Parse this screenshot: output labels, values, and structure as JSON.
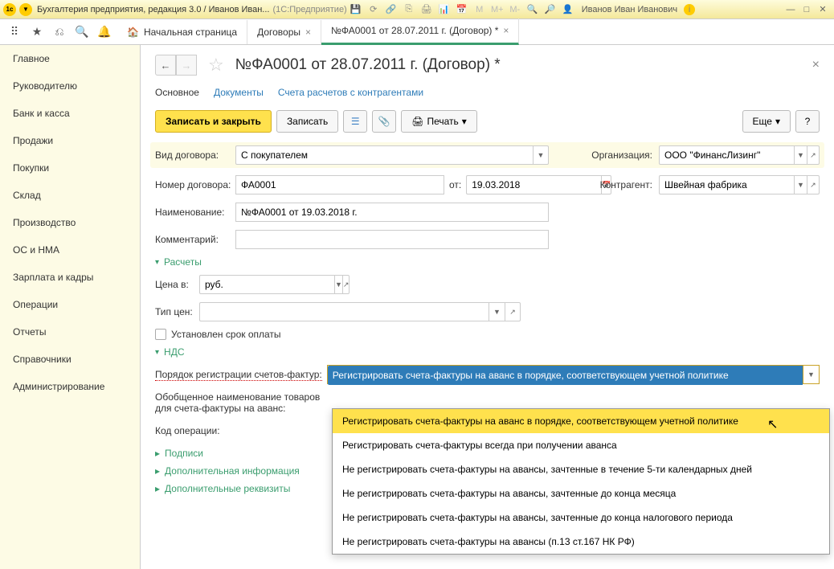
{
  "titlebar": {
    "app_title": "Бухгалтерия предприятия, редакция 3.0 / Иванов Иван...",
    "platform": "(1С:Предприятие)",
    "user": "Иванов Иван Иванович"
  },
  "tabs": {
    "home": "Начальная страница",
    "t1": "Договоры",
    "t2": "№ФА0001 от 28.07.2011 г. (Договор) *"
  },
  "sidebar": {
    "items": [
      "Главное",
      "Руководителю",
      "Банк и касса",
      "Продажи",
      "Покупки",
      "Склад",
      "Производство",
      "ОС и НМА",
      "Зарплата и кадры",
      "Операции",
      "Отчеты",
      "Справочники",
      "Администрирование"
    ]
  },
  "page": {
    "title": "№ФА0001 от 28.07.2011 г. (Договор) *",
    "subtabs": {
      "main": "Основное",
      "docs": "Документы",
      "calc": "Счета расчетов с контрагентами"
    },
    "actions": {
      "save_close": "Записать и закрыть",
      "save": "Записать",
      "print": "Печать",
      "more": "Еще",
      "help": "?"
    },
    "form": {
      "contract_type_label": "Вид договора:",
      "contract_type_value": "С покупателем",
      "org_label": "Организация:",
      "org_value": "ООО \"ФинансЛизинг\"",
      "number_label": "Номер договора:",
      "number_value": "ФА0001",
      "from_label": "от:",
      "from_value": "19.03.2018",
      "counterparty_label": "Контрагент:",
      "counterparty_value": "Швейная фабрика",
      "name_label": "Наименование:",
      "name_value": "№ФА0001 от 19.03.2018 г.",
      "comment_label": "Комментарий:",
      "calcs_header": "Расчеты",
      "price_in_label": "Цена в:",
      "price_in_value": "руб.",
      "price_type_label": "Тип цен:",
      "payment_term_label": "Установлен срок оплаты",
      "vat_header": "НДС",
      "invoice_order_label": "Порядок регистрации счетов-фактур:",
      "invoice_order_value": "Регистрировать счета-фактуры на аванс в порядке, соответствующем учетной политике",
      "goods_name_label1": "Обобщенное наименование товаров",
      "goods_name_label2": "для счета-фактуры на аванс:",
      "op_code_label": "Код операции:",
      "signatures": "Подписи",
      "add_info": "Дополнительная информация",
      "add_req": "Дополнительные реквизиты"
    },
    "dropdown_options": [
      "Регистрировать счета-фактуры на аванс в порядке, соответствующем учетной политике",
      "Регистрировать счета-фактуры всегда при получении аванса",
      "Не регистрировать счета-фактуры на авансы, зачтенные в течение 5-ти календарных дней",
      "Не регистрировать счета-фактуры на авансы, зачтенные до конца месяца",
      "Не регистрировать счета-фактуры на авансы, зачтенные до конца налогового периода",
      "Не регистрировать счета-фактуры на авансы (п.13 ст.167 НК РФ)"
    ]
  }
}
